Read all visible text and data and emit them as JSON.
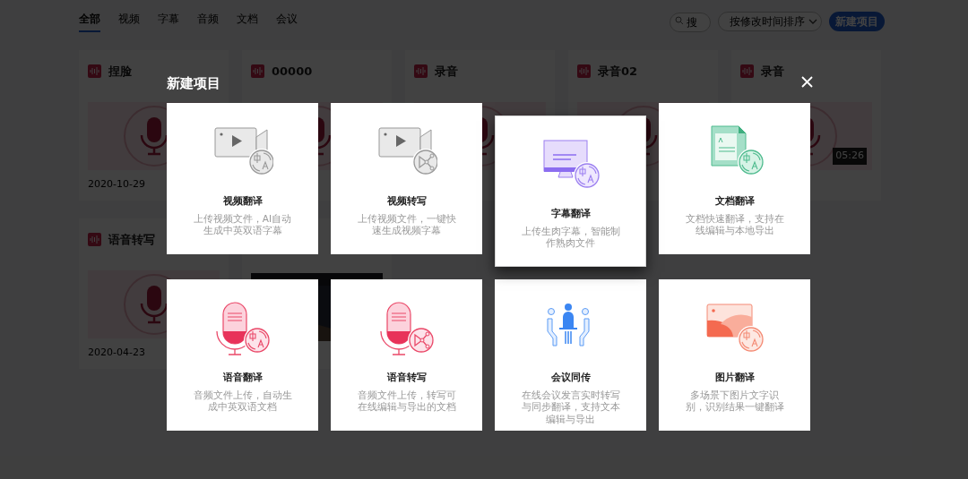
{
  "nav_tabs": [
    {
      "label": "全部",
      "selected": true
    },
    {
      "label": "视频",
      "selected": false
    },
    {
      "label": "字幕",
      "selected": false
    },
    {
      "label": "音频",
      "selected": false
    },
    {
      "label": "文档",
      "selected": false
    },
    {
      "label": "会议",
      "selected": false
    }
  ],
  "search": {
    "placeholder": "搜"
  },
  "sort": {
    "label": "按修改时间排序"
  },
  "new_button": "新建项目",
  "projects": [
    {
      "title": "捏脸",
      "date": "2020-10-29",
      "kind": "audio"
    },
    {
      "title": "00000",
      "kind": "audio"
    },
    {
      "title": "录音",
      "kind": "audio"
    },
    {
      "title": "录音02",
      "kind": "audio"
    },
    {
      "title": "录音",
      "kind": "audio",
      "duration": "05:26"
    },
    {
      "title": "语音转写",
      "date": "2020-04-23",
      "kind": "audio"
    },
    {
      "kind": "picture"
    }
  ],
  "modal": {
    "title": "新建项目",
    "options": [
      {
        "kind": "video-translate",
        "title": "视频翻译",
        "description": "上传视频文件，AI自动生成中英双语字幕",
        "hovered": false
      },
      {
        "kind": "video-transcribe",
        "title": "视频转写",
        "description": "上传视频文件，一键快速生成视频字幕",
        "hovered": false
      },
      {
        "kind": "subtitle-translate",
        "title": "字幕翻译",
        "description": "上传生肉字幕，智能制作熟肉文件",
        "hovered": true
      },
      {
        "kind": "document-translate",
        "title": "文档翻译",
        "description": "文档快速翻译，支持在线编辑与本地导出",
        "hovered": false
      },
      {
        "kind": "audio-translate",
        "title": "语音翻译",
        "description": "音频文件上传，自动生成中英双语文档",
        "hovered": false
      },
      {
        "kind": "audio-transcribe",
        "title": "语音转写",
        "description": "音频文件上传，转写可在线编辑与导出的文档",
        "hovered": false
      },
      {
        "kind": "meeting",
        "title": "会议同传",
        "description": "在线会议发言实时转写与同步翻译，支持文本编辑与导出",
        "hovered": false
      },
      {
        "kind": "image-translate",
        "title": "图片翻译",
        "description": "多场景下图片文字识别，识别结果一键翻译",
        "hovered": false
      }
    ]
  }
}
